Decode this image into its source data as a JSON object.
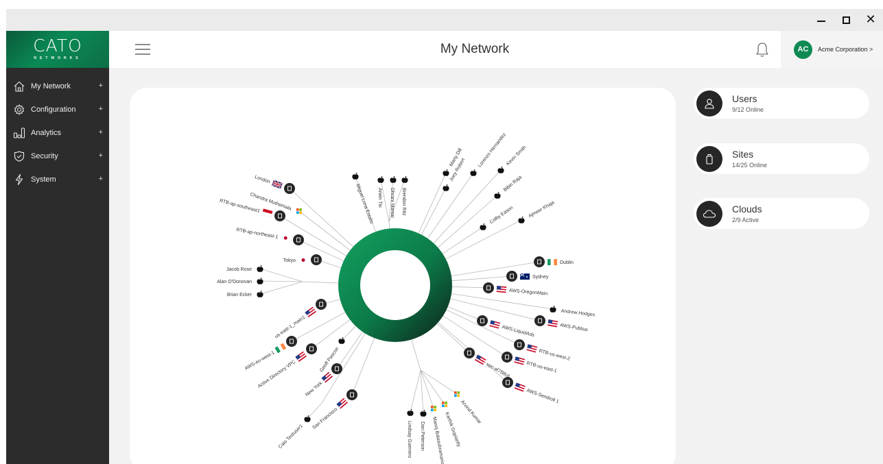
{
  "window": {
    "minimize": "–",
    "maximize": "",
    "close": "✕"
  },
  "brand": {
    "name": "CATO",
    "subtitle": "NETWORKS"
  },
  "nav": [
    {
      "label": "My Network",
      "icon": "home-icon"
    },
    {
      "label": "Configuration",
      "icon": "gear-icon"
    },
    {
      "label": "Analytics",
      "icon": "bar-chart-icon"
    },
    {
      "label": "Security",
      "icon": "shield-check-icon"
    },
    {
      "label": "System",
      "icon": "lightning-icon"
    }
  ],
  "nav_expand": "+",
  "header": {
    "title": "My Network",
    "account_initials": "AC",
    "account_name": "Acme Corporation >"
  },
  "stats": [
    {
      "title": "Users",
      "sub": "9/12 Online",
      "icon": "user-icon"
    },
    {
      "title": "Sites",
      "sub": "14/25 Online",
      "icon": "site-icon"
    },
    {
      "title": "Clouds",
      "sub": "2/9 Active",
      "icon": "cloud-icon"
    }
  ],
  "colors": {
    "accent": "#0f8a53",
    "sidebar": "#2c2c2c",
    "ring_dark": "#0d3d2a",
    "node": "#262626"
  },
  "network": {
    "nodes": [
      {
        "label": "Miguel Luna Estallo",
        "icon": "apple",
        "flag": ""
      },
      {
        "label": "Arwin Tio",
        "icon": "apple",
        "flag": ""
      },
      {
        "label": "Dhrani Maniar",
        "icon": "apple",
        "flag": ""
      },
      {
        "label": "Brendon Ritz",
        "icon": "apple",
        "flag": ""
      },
      {
        "label": "Marty Dill",
        "icon": "apple",
        "flag": ""
      },
      {
        "label": "Joey Robert",
        "icon": "apple",
        "flag": ""
      },
      {
        "label": "Lorenzo Hernandez",
        "icon": "apple",
        "flag": ""
      },
      {
        "label": "Kevin Smith",
        "icon": "apple",
        "flag": ""
      },
      {
        "label": "Bibin Raja",
        "icon": "apple",
        "flag": ""
      },
      {
        "label": "Colby Eason",
        "icon": "apple",
        "flag": ""
      },
      {
        "label": "Ajmeer Khaja",
        "icon": "apple",
        "flag": ""
      },
      {
        "label": "Dublin",
        "icon": "site",
        "flag": "ie"
      },
      {
        "label": "Sydney",
        "icon": "site",
        "flag": "au"
      },
      {
        "label": "AWS-OregonMain",
        "icon": "site",
        "flag": "us"
      },
      {
        "label": "Andrew Hodges",
        "icon": "apple",
        "flag": ""
      },
      {
        "label": "AWS-Publius",
        "icon": "site",
        "flag": "us"
      },
      {
        "label": "AWS-LiquidAds",
        "icon": "site",
        "flag": "us"
      },
      {
        "label": "RTB-us-west-2",
        "icon": "site",
        "flag": "us"
      },
      {
        "label": "RTB-us-east-1",
        "icon": "site",
        "flag": "us"
      },
      {
        "label": "vpc-af7f9fc6",
        "icon": "site",
        "flag": "us"
      },
      {
        "label": "AWS-Sendroll 1",
        "icon": "site",
        "flag": "us"
      },
      {
        "label": "Arvind Kumar",
        "icon": "windows",
        "flag": ""
      },
      {
        "label": "Karthik Gopisetty",
        "icon": "windows",
        "flag": ""
      },
      {
        "label": "Manoj Balasubramanian",
        "icon": "windows",
        "flag": ""
      },
      {
        "label": "Dan Peterson",
        "icon": "apple",
        "flag": ""
      },
      {
        "label": "Lindsay Guerrero",
        "icon": "apple",
        "flag": ""
      },
      {
        "label": "San Francisco",
        "icon": "site",
        "flag": "us"
      },
      {
        "label": "Cato Testuser1",
        "icon": "apple",
        "flag": ""
      },
      {
        "label": "New York",
        "icon": "site",
        "flag": "us"
      },
      {
        "label": "Geoff Pascoe",
        "icon": "apple",
        "flag": ""
      },
      {
        "label": "Active Directory VPC",
        "icon": "site",
        "flag": "us"
      },
      {
        "label": "AWS-eu-west-1",
        "icon": "site",
        "flag": "ie"
      },
      {
        "label": "us-east-1_main1",
        "icon": "site",
        "flag": "us"
      },
      {
        "label": "Brian Ecker",
        "icon": "apple",
        "flag": ""
      },
      {
        "label": "Alan O'Donovan",
        "icon": "apple",
        "flag": ""
      },
      {
        "label": "Jacob Rose",
        "icon": "apple",
        "flag": ""
      },
      {
        "label": "Tokyo",
        "icon": "site",
        "flag": "jp"
      },
      {
        "label": "RTB-ap-northeast-1",
        "icon": "site",
        "flag": "jp"
      },
      {
        "label": "RTB-ap-southeast1",
        "icon": "site",
        "flag": "id"
      },
      {
        "label": "Chandra Muthemala",
        "icon": "windows",
        "flag": ""
      },
      {
        "label": "London",
        "icon": "site",
        "flag": "gb"
      }
    ]
  }
}
